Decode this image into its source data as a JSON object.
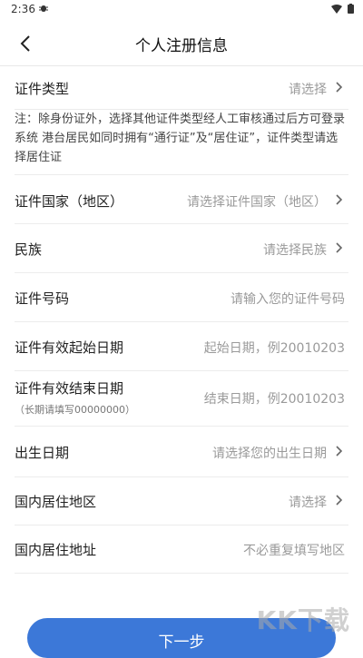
{
  "status_bar": {
    "time": "2:36",
    "bug_icon": "bug-icon",
    "wifi_icon": "wifi-icon",
    "battery_icon": "battery-icon"
  },
  "header": {
    "title": "个人注册信息",
    "back_icon": "chevron-left-icon"
  },
  "form": {
    "document_type": {
      "label": "证件类型",
      "value": "请选择"
    },
    "note": "注：除身份证外，选择其他证件类型经人工审核通过后方可登录系统 港台居民如同时拥有“通行证”及“居住证”，证件类型请选择居住证",
    "country": {
      "label": "证件国家（地区）",
      "value": "请选择证件国家（地区）"
    },
    "ethnicity": {
      "label": "民族",
      "value": "请选择民族"
    },
    "id_number": {
      "label": "证件号码",
      "placeholder": "请输入您的证件号码"
    },
    "valid_start": {
      "label": "证件有效起始日期",
      "placeholder": "起始日期，例20010203"
    },
    "valid_end": {
      "label": "证件有效结束日期",
      "sublabel": "（长期请填写00000000）",
      "placeholder": "结束日期，例20010203"
    },
    "birthdate": {
      "label": "出生日期",
      "value": "请选择您的出生日期"
    },
    "residence_area": {
      "label": "国内居住地区",
      "value": "请选择"
    },
    "residence_address": {
      "label": "国内居住地址",
      "placeholder": "不必重复填写地区"
    }
  },
  "actions": {
    "next_label": "下一步"
  },
  "watermark": "KK下载",
  "colors": {
    "primary": "#3c78d8",
    "placeholder": "#9a9a9a"
  }
}
